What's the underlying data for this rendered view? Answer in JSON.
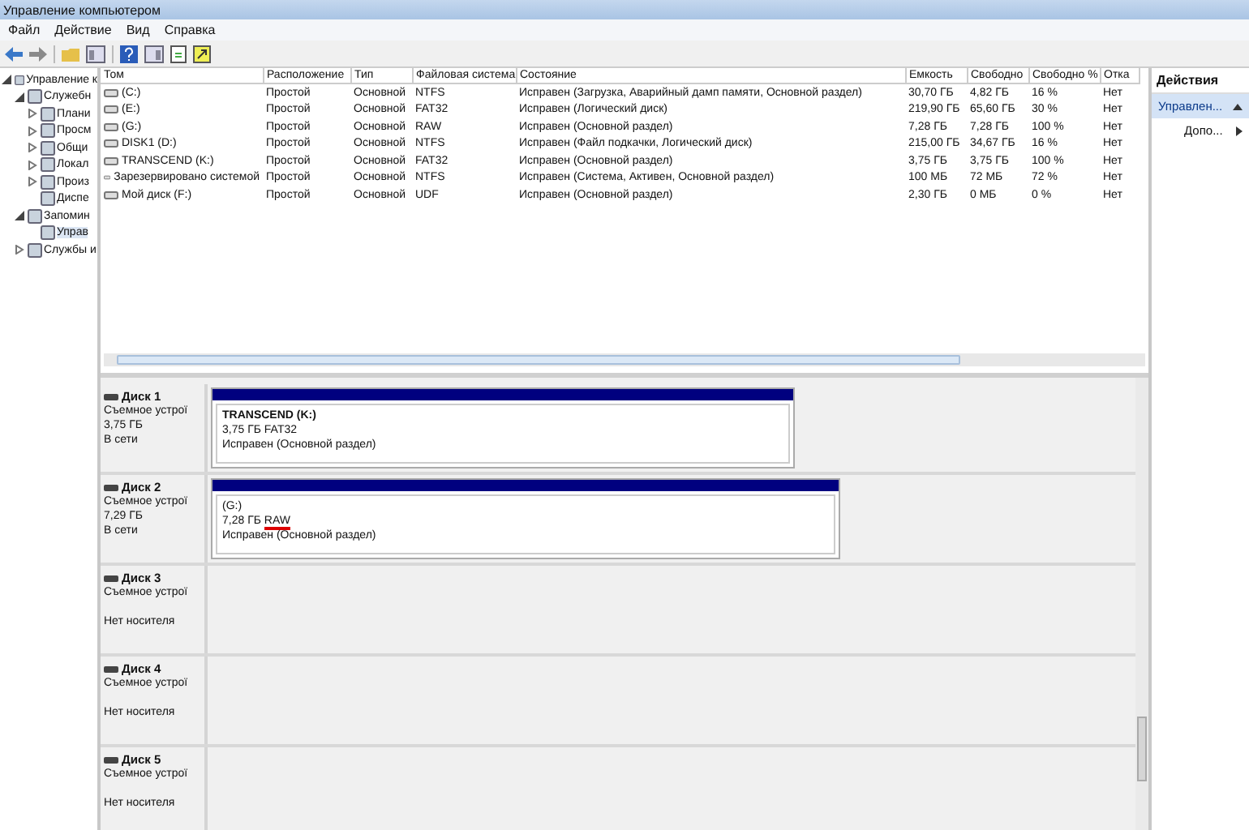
{
  "window": {
    "title": "Управление компьютером"
  },
  "menu": [
    "Файл",
    "Действие",
    "Вид",
    "Справка"
  ],
  "tree": [
    {
      "label": "Управление к",
      "expanded": true,
      "children": [
        {
          "label": "Служебн",
          "expanded": true,
          "children": [
            {
              "label": "Плани",
              "expanded": false
            },
            {
              "label": "Просм",
              "expanded": false
            },
            {
              "label": "Общи",
              "expanded": false
            },
            {
              "label": "Локал",
              "expanded": false
            },
            {
              "label": "Произ",
              "expanded": false
            },
            {
              "label": "Диспе"
            }
          ]
        },
        {
          "label": "Запомин",
          "expanded": true,
          "children": [
            {
              "label": "Управ",
              "selected": true
            }
          ]
        },
        {
          "label": "Службы и",
          "expanded": false
        }
      ]
    }
  ],
  "table": {
    "columns": [
      "Том",
      "Расположение",
      "Тип",
      "Файловая система",
      "Состояние",
      "Емкость",
      "Свободно",
      "Свободно %",
      "Отка"
    ],
    "rows": [
      [
        "(C:)",
        "Простой",
        "Основной",
        "NTFS",
        "Исправен (Загрузка, Аварийный дамп памяти, Основной раздел)",
        "30,70 ГБ",
        "4,82 ГБ",
        "16 %",
        "Нет"
      ],
      [
        "(E:)",
        "Простой",
        "Основной",
        "FAT32",
        "Исправен (Логический диск)",
        "219,90 ГБ",
        "65,60 ГБ",
        "30 %",
        "Нет"
      ],
      [
        "(G:)",
        "Простой",
        "Основной",
        "RAW",
        "Исправен (Основной раздел)",
        "7,28 ГБ",
        "7,28 ГБ",
        "100 %",
        "Нет"
      ],
      [
        "DISK1 (D:)",
        "Простой",
        "Основной",
        "NTFS",
        "Исправен (Файл подкачки, Логический диск)",
        "215,00 ГБ",
        "34,67 ГБ",
        "16 %",
        "Нет"
      ],
      [
        "TRANSCEND (K:)",
        "Простой",
        "Основной",
        "FAT32",
        "Исправен (Основной раздел)",
        "3,75 ГБ",
        "3,75 ГБ",
        "100 %",
        "Нет"
      ],
      [
        "Зарезервировано системой",
        "Простой",
        "Основной",
        "NTFS",
        "Исправен (Система, Активен, Основной раздел)",
        "100 МБ",
        "72 МБ",
        "72 %",
        "Нет"
      ],
      [
        "Мой диск (F:)",
        "Простой",
        "Основной",
        "UDF",
        "Исправен (Основной раздел)",
        "2,30 ГБ",
        "0 МБ",
        "0 %",
        "Нет"
      ]
    ]
  },
  "disks": [
    {
      "name": "Диск 1",
      "type": "Съемное устрої",
      "size": "3,75 ГБ",
      "status": "В сети",
      "partition": {
        "name": "TRANSCEND  (K:)",
        "bold": true,
        "size": "3,75 ГБ",
        "filesystem": "FAT32",
        "underlined": false,
        "status": "Исправен (Основной раздел)"
      }
    },
    {
      "name": "Диск 2",
      "type": "Съемное устрої",
      "size": "7,29 ГБ",
      "status": "В сети",
      "partition": {
        "name": "(G:)",
        "bold": false,
        "size": "7,28 ГБ",
        "filesystem": "RAW",
        "underlined": true,
        "status": "Исправен (Основной раздел)"
      }
    },
    {
      "name": "Диск 3",
      "type": "Съемное устрої",
      "status": "Нет носителя"
    },
    {
      "name": "Диск 4",
      "type": "Съемное устрої",
      "status": "Нет носителя"
    },
    {
      "name": "Диск 5",
      "type": "Съемное устрої",
      "status": "Нет носителя"
    }
  ],
  "actions": {
    "title": "Действия",
    "items": [
      {
        "label": "Управлен...",
        "kind": "section",
        "selected": true
      },
      {
        "label": "Допо...",
        "kind": "submenu",
        "selected": false
      }
    ]
  }
}
